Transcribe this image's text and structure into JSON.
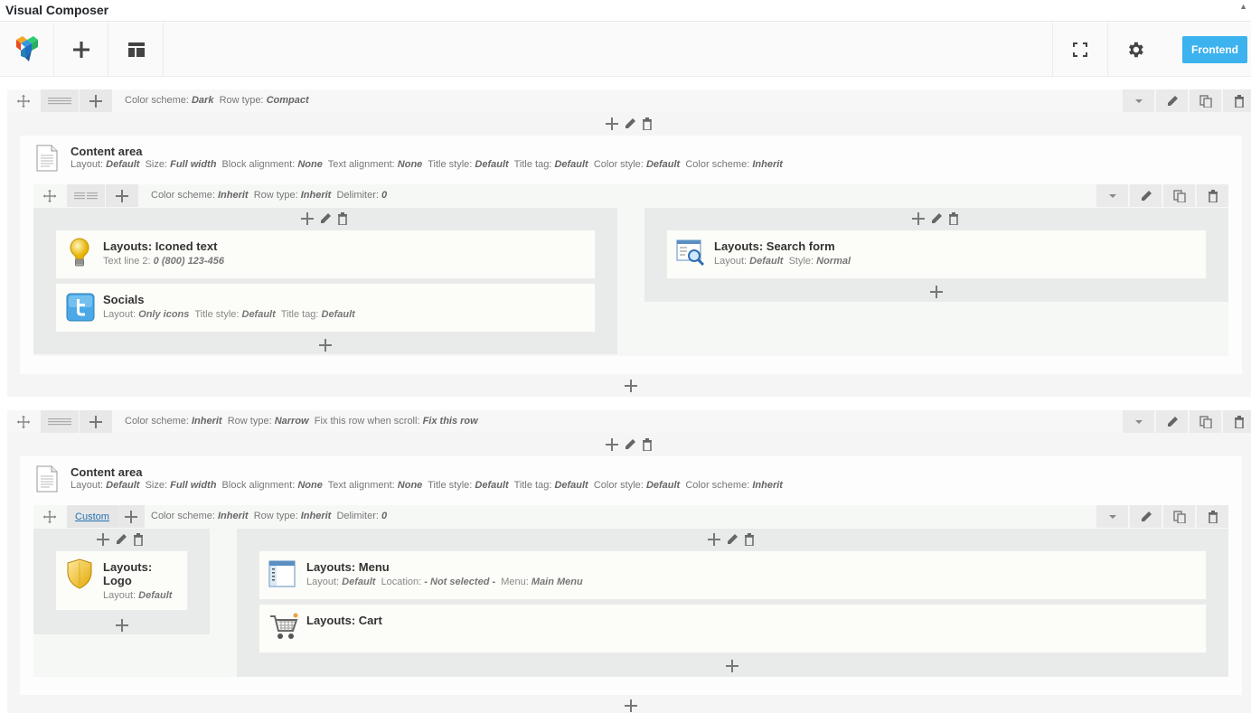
{
  "app": {
    "title": "Visual Composer",
    "collapse_glyph": "▲"
  },
  "toolbar": {
    "frontend_label": "Frontend"
  },
  "row1": {
    "meta": [
      {
        "label": "Color scheme:",
        "value": "Dark"
      },
      {
        "label": "Row type:",
        "value": "Compact"
      }
    ],
    "content_title": "Content area",
    "content_meta": [
      {
        "label": "Layout:",
        "value": "Default"
      },
      {
        "label": "Size:",
        "value": "Full width"
      },
      {
        "label": "Block alignment:",
        "value": "None"
      },
      {
        "label": "Text alignment:",
        "value": "None"
      },
      {
        "label": "Title style:",
        "value": "Default"
      },
      {
        "label": "Title tag:",
        "value": "Default"
      },
      {
        "label": "Color style:",
        "value": "Default"
      },
      {
        "label": "Color scheme:",
        "value": "Inherit"
      }
    ],
    "inner_meta": [
      {
        "label": "Color scheme:",
        "value": "Inherit"
      },
      {
        "label": "Row type:",
        "value": "Inherit"
      },
      {
        "label": "Delimiter:",
        "value": "0"
      }
    ],
    "elements": {
      "iconed_text": {
        "title": "Layouts: Iconed text",
        "meta": [
          {
            "label": "Text line 2:",
            "value": "0 (800) 123-456"
          }
        ]
      },
      "socials": {
        "title": "Socials",
        "meta": [
          {
            "label": "Layout:",
            "value": "Only icons"
          },
          {
            "label": "Title style:",
            "value": "Default"
          },
          {
            "label": "Title tag:",
            "value": "Default"
          }
        ]
      },
      "search_form": {
        "title": "Layouts: Search form",
        "meta": [
          {
            "label": "Layout:",
            "value": "Default"
          },
          {
            "label": "Style:",
            "value": "Normal"
          }
        ]
      }
    }
  },
  "row2": {
    "meta": [
      {
        "label": "Color scheme:",
        "value": "Inherit"
      },
      {
        "label": "Row type:",
        "value": "Narrow"
      },
      {
        "label": "Fix this row when scroll:",
        "value": "Fix this row"
      }
    ],
    "content_title": "Content area",
    "content_meta": [
      {
        "label": "Layout:",
        "value": "Default"
      },
      {
        "label": "Size:",
        "value": "Full width"
      },
      {
        "label": "Block alignment:",
        "value": "None"
      },
      {
        "label": "Text alignment:",
        "value": "None"
      },
      {
        "label": "Title style:",
        "value": "Default"
      },
      {
        "label": "Title tag:",
        "value": "Default"
      },
      {
        "label": "Color style:",
        "value": "Default"
      },
      {
        "label": "Color scheme:",
        "value": "Inherit"
      }
    ],
    "custom_label": "Custom",
    "inner_meta": [
      {
        "label": "Color scheme:",
        "value": "Inherit"
      },
      {
        "label": "Row type:",
        "value": "Inherit"
      },
      {
        "label": "Delimiter:",
        "value": "0"
      }
    ],
    "elements": {
      "logo": {
        "title_line1": "Layouts:",
        "title_line2": "Logo",
        "meta": [
          {
            "label": "Layout:",
            "value": "Default"
          }
        ]
      },
      "menu": {
        "title": "Layouts: Menu",
        "meta": [
          {
            "label": "Layout:",
            "value": "Default"
          },
          {
            "label": "Location:",
            "value": "- Not selected -"
          },
          {
            "label": "Menu:",
            "value": "Main Menu"
          }
        ]
      },
      "cart": {
        "title": "Layouts: Cart"
      }
    }
  },
  "colors": {
    "accent": "#3cb2ef",
    "icon": "#555555"
  }
}
